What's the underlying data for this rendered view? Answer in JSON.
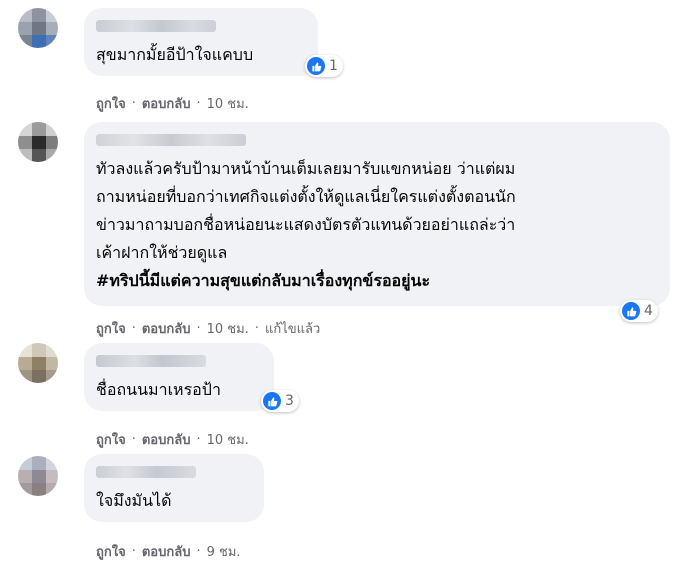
{
  "comments": [
    {
      "text_lines": [
        "สุขมากมั้ยอีป้าใจแคบบ"
      ],
      "hashtag": "",
      "reaction_count": "1",
      "reaction_icon": "like-icon",
      "actions": {
        "like": "ถูกใจ",
        "reply": "ตอบกลับ",
        "time": "10 ชม.",
        "edited": ""
      }
    },
    {
      "text_lines": [
        "ทัวลงแล้วครับป้ามาหน้าบ้านเต็มเลยมารับแขกหน่อย ว่าแต่ผม",
        "ถามหน่อยที่บอกว่าเทศกิจแต่งตั้งให้ดูแลเนี่ยใครแต่งตั้งตอนนัก",
        "ข่าวมาถามบอกชื่อหน่อยนะแสดงบัตรตัวแทนด้วยอย่าแถล่ะว่า",
        "เค้าฝากให้ช่วยดูแล"
      ],
      "hashtag": "#ทริปนี้มีแต่ความสุขแต่กลับมาเรื่องทุกข์รออยู่นะ",
      "reaction_count": "4",
      "reaction_icon": "like-icon",
      "actions": {
        "like": "ถูกใจ",
        "reply": "ตอบกลับ",
        "time": "10 ชม.",
        "edited": "แก้ไขแล้ว"
      }
    },
    {
      "text_lines": [
        "ชื่อถนนมาเหรอป้า"
      ],
      "hashtag": "",
      "reaction_count": "3",
      "reaction_icon": "like-icon",
      "actions": {
        "like": "ถูกใจ",
        "reply": "ตอบกลับ",
        "time": "10 ชม.",
        "edited": ""
      }
    },
    {
      "text_lines": [
        "ใจมึงมันได้"
      ],
      "hashtag": "",
      "reaction_count": "",
      "reaction_icon": "",
      "actions": {
        "like": "ถูกใจ",
        "reply": "ตอบกลับ",
        "time": "9 ชม.",
        "edited": ""
      }
    }
  ],
  "separator": "·",
  "colors": {
    "bubble": "#f0f2f5",
    "like_blue": "#1877f2",
    "meta_gray": "#65676b"
  }
}
